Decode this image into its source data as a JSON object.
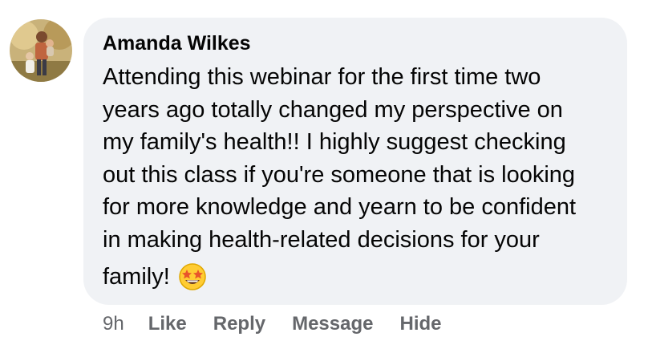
{
  "comment": {
    "author": "Amanda Wilkes",
    "lines": [
      "Attending this webinar for the first time two",
      "years ago totally changed my perspective on",
      "my family's health!! I highly suggest checking",
      "out this class if you're someone that is looking",
      "for more knowledge and yearn to be confident",
      "in making health-related decisions for your"
    ],
    "last_line": "family!",
    "emoji": "star-struck-emoji",
    "avatar_icon": "profile-photo"
  },
  "footer": {
    "timestamp": "9h",
    "like": "Like",
    "reply": "Reply",
    "message": "Message",
    "hide": "Hide"
  },
  "colors": {
    "bubble": "#f0f2f5",
    "text": "#050505",
    "meta": "#65676b"
  }
}
